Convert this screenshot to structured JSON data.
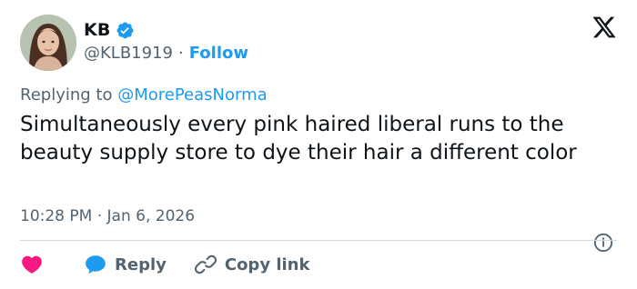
{
  "author": {
    "display_name": "KB",
    "handle": "@KLB1919",
    "separator": "·",
    "follow_label": "Follow",
    "verified": true
  },
  "reply_context": {
    "prefix": "Replying to",
    "mention": "@MorePeasNorma"
  },
  "tweet": {
    "text": "Simultaneously every pink haired liberal runs to the beauty supply store to dye their hair a different color",
    "timestamp": "10:28 PM · Jan 6, 2026"
  },
  "actions": {
    "reply_label": "Reply",
    "copy_link_label": "Copy link"
  },
  "colors": {
    "accent": "#1d9bf0",
    "like": "#f91880",
    "muted": "#536471",
    "text": "#0f1419",
    "divider": "#cfd9de"
  },
  "icons": {
    "brand": "x-logo-icon",
    "verified": "verified-badge-icon",
    "info": "info-icon",
    "like": "heart-icon",
    "reply": "speech-bubble-icon",
    "copy_link": "link-icon"
  }
}
